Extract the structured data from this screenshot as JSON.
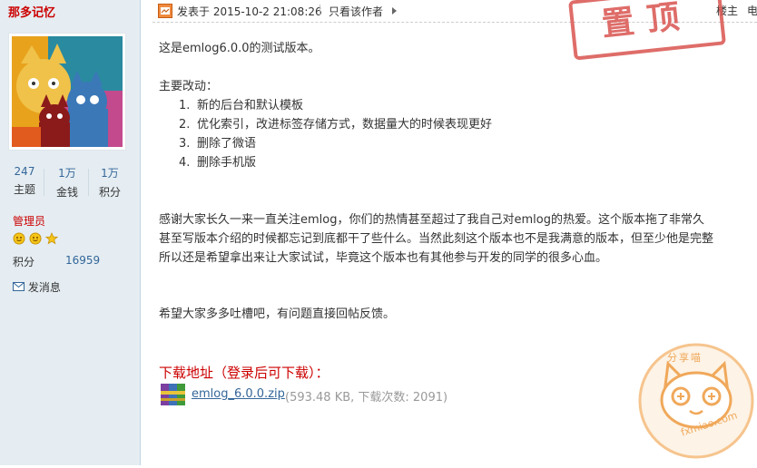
{
  "sidebar": {
    "username": "那多记忆",
    "stats": [
      {
        "value": "247",
        "label": "主题"
      },
      {
        "value": "1万",
        "label": "金钱"
      },
      {
        "value": "1万",
        "label": "积分"
      }
    ],
    "role": "管理员",
    "points_label": "积分",
    "points_value": "16959",
    "message_label": "发消息"
  },
  "post_header": {
    "posted_at": "发表于 2015-10-2 21:08:26",
    "author_only": "只看该作者",
    "floor": "楼主",
    "cut_text": "电"
  },
  "stamp_text": "置顶",
  "post": {
    "intro": "这是emlog6.0.0的测试版本。",
    "changes_title": "主要改动：",
    "changes": [
      {
        "num": "1.",
        "text": "新的后台和默认模板"
      },
      {
        "num": "2.",
        "text": "优化索引，改进标签存储方式，数据量大的时候表现更好"
      },
      {
        "num": "3.",
        "text": "删除了微语"
      },
      {
        "num": "4.",
        "text": "删除手机版"
      }
    ],
    "thanks_lines": [
      "感谢大家长久一来一直关注emlog，你们的热情甚至超过了我自己对emlog的热爱。这个版本拖了非常久",
      "甚至写版本介绍的时候都忘记到底都干了些什么。当然此刻这个版本也不是我满意的版本，但至少他是完整",
      "所以还是希望拿出来让大家试试，毕竟这个版本也有其他参与开发的同学的很多心血。"
    ],
    "feedback": "希望大家多多吐槽吧，有问题直接回帖反馈。",
    "download_title": "下载地址（登录后可下载）：",
    "attachment_name": "emlog_6.0.0.zip",
    "attachment_meta": "(593.48 KB, 下载次数: 2091)"
  },
  "watermark": {
    "top": "分享喵",
    "bottom": "fxmiao.com"
  }
}
